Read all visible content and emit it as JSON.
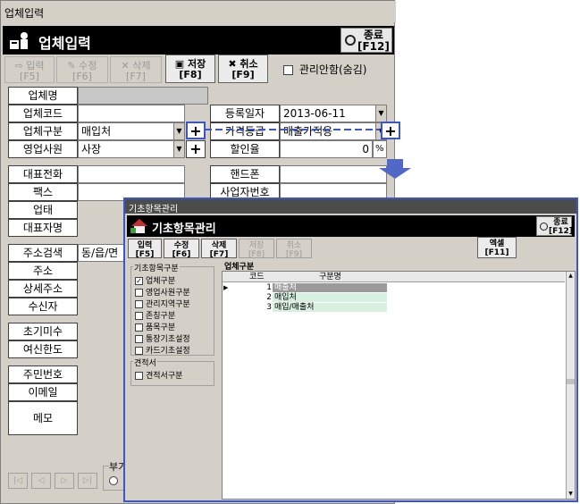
{
  "main": {
    "title_bar": "업체입력",
    "header_title": "업체입력",
    "close_button": {
      "label": "종료",
      "key": "[F12]"
    },
    "toolbar": [
      {
        "label": "입력",
        "key": "[F5]",
        "enabled": false
      },
      {
        "label": "수정",
        "key": "[F6]",
        "enabled": false
      },
      {
        "label": "삭제",
        "key": "[F7]",
        "enabled": false
      },
      {
        "label": "저장",
        "key": "[F8]",
        "enabled": true
      },
      {
        "label": "취소",
        "key": "[F9]",
        "enabled": true
      }
    ],
    "checkbox_label": "관리안함(숨김)",
    "fields": {
      "name_label": "업체명",
      "code_label": "업체코드",
      "type_label": "업체구분",
      "type_value": "매입처",
      "sales_label": "영업사원",
      "sales_value": "사장",
      "reg_date_label": "등록일자",
      "reg_date_value": "2013-06-11",
      "price_grade_label": "가격등급",
      "price_grade_value": "매출가적용",
      "discount_label": "할인율",
      "discount_value": "0",
      "discount_unit": "%",
      "phone_label": "대표전화",
      "mobile_label": "핸드폰",
      "fax_label": "팩스",
      "biz_no_label": "사업자번호",
      "status_label": "업태",
      "ceo_label": "대표자명",
      "address_search_label": "주소검색",
      "address_search_value": "동/읍/면",
      "address_label": "주소",
      "address_detail_label": "상세주소",
      "receiver_label": "수신자",
      "initial_balance_label": "초기미수",
      "credit_limit_label": "여신한도",
      "resident_no_label": "주민번호",
      "email_label": "이메일",
      "memo_label": "메모",
      "extra_partial": "부가"
    }
  },
  "popup": {
    "title_bar": "기초항목관리",
    "header_title": "기초항목관리",
    "close_button": {
      "label": "종료",
      "key": "[F12]"
    },
    "toolbar": [
      {
        "label": "입력",
        "key": "[F5]",
        "enabled": true
      },
      {
        "label": "수정",
        "key": "[F6]",
        "enabled": true
      },
      {
        "label": "삭제",
        "key": "[F7]",
        "enabled": true
      },
      {
        "label": "저장",
        "key": "[F8]",
        "enabled": false
      },
      {
        "label": "취소",
        "key": "[F9]",
        "enabled": false
      }
    ],
    "excel_button": {
      "label": "엑셀",
      "key": "[F11]"
    },
    "category_group_title": "기초항목구분",
    "categories": [
      {
        "label": "업체구분",
        "checked": true
      },
      {
        "label": "영업사원구분",
        "checked": false
      },
      {
        "label": "관리지역구분",
        "checked": false
      },
      {
        "label": "존칭구분",
        "checked": false
      },
      {
        "label": "품목구분",
        "checked": false
      },
      {
        "label": "통장기초설정",
        "checked": false
      },
      {
        "label": "카드기초설정",
        "checked": false
      }
    ],
    "estimate_group_title": "견적서",
    "estimate_items": [
      {
        "label": "견적서구분",
        "checked": false
      }
    ],
    "grid_title": "업체구분",
    "grid_columns": [
      "코드",
      "구분명"
    ],
    "grid_rows": [
      {
        "code": "1",
        "name": "매출처"
      },
      {
        "code": "2",
        "name": "매입처"
      },
      {
        "code": "3",
        "name": "매입/매출처"
      }
    ]
  }
}
